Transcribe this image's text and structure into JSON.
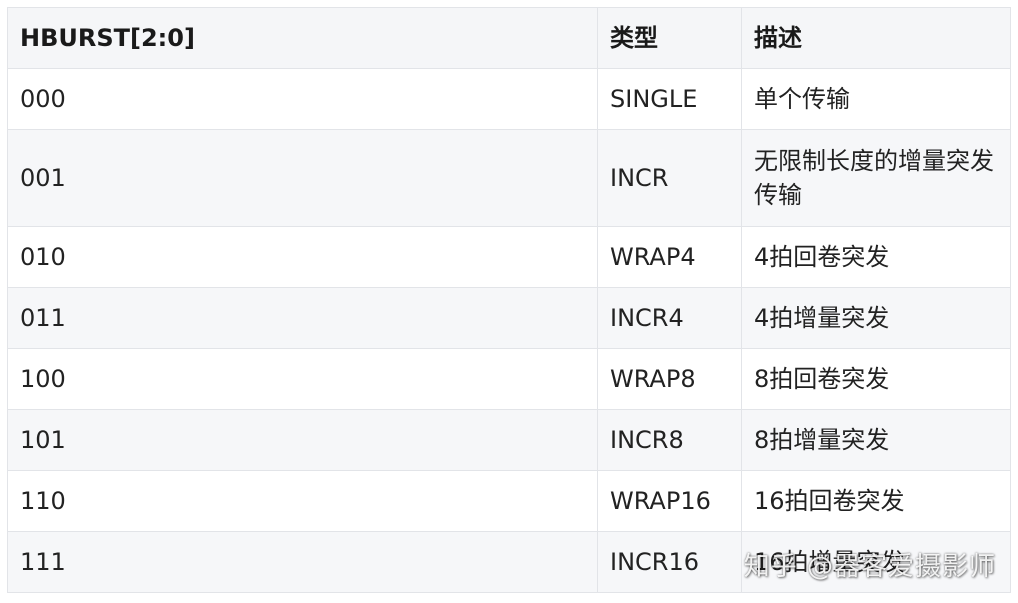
{
  "table": {
    "headers": [
      "HBURST[2:0]",
      "类型",
      "描述"
    ],
    "rows": [
      {
        "code": "000",
        "type": "SINGLE",
        "desc": "单个传输"
      },
      {
        "code": "001",
        "type": "INCR",
        "desc": "无限制长度的增量突发传输"
      },
      {
        "code": "010",
        "type": "WRAP4",
        "desc": "4拍回卷突发"
      },
      {
        "code": "011",
        "type": "INCR4",
        "desc": "4拍增量突发"
      },
      {
        "code": "100",
        "type": "WRAP8",
        "desc": "8拍回卷突发"
      },
      {
        "code": "101",
        "type": "INCR8",
        "desc": "8拍增量突发"
      },
      {
        "code": "110",
        "type": "WRAP16",
        "desc": "16拍回卷突发"
      },
      {
        "code": "111",
        "type": "INCR16",
        "desc": "16拍增量突发"
      }
    ]
  },
  "watermark": "知乎 @器客爱摄影师"
}
